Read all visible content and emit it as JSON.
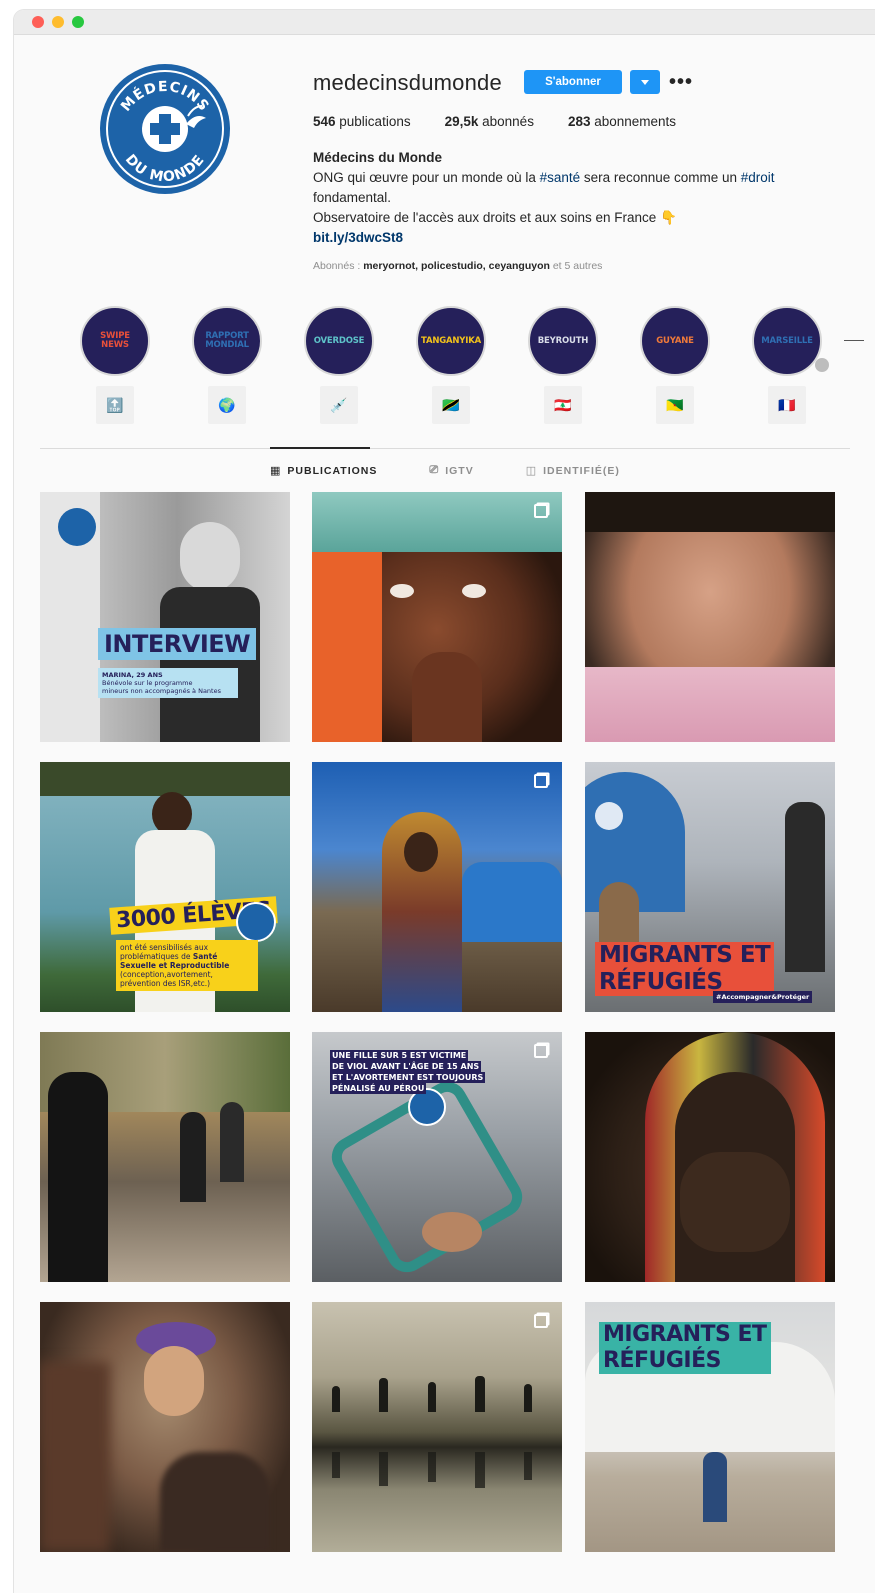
{
  "profile": {
    "username": "medecinsdumonde",
    "follow_label": "S'abonner",
    "more_label": "•••",
    "stats": {
      "posts_count": "546",
      "posts_label": " publications",
      "followers_count": "29,5k",
      "followers_label": " abonnés",
      "following_count": "283",
      "following_label": " abonnements"
    },
    "bio": {
      "name": "Médecins du Monde",
      "line1_a": "ONG qui œuvre pour un monde où la ",
      "line1_tag1": "#santé",
      "line1_b": " sera reconnue comme un ",
      "line1_tag2": "#droit",
      "line2": "fondamental.",
      "line3": "Observatoire de l'accès aux droits et aux soins en France 👇",
      "link": "bit.ly/3dwcSt8"
    },
    "followed_by_prefix": "Abonnés : ",
    "followed_by_names": "meryornot, policestudio, ceyanguyon",
    "followed_by_suffix": " et 5 autres"
  },
  "logo": {
    "top_text": "MÉDECINS",
    "bottom_text": "DU MONDE",
    "color": "#1d63a8"
  },
  "highlights": [
    {
      "label": "SWIPE\nNEWS",
      "color": "#e8503a",
      "emoji": "🔝"
    },
    {
      "label": "RAPPORT\nMONDIAL",
      "color": "#2f6fb3",
      "emoji": "🌍"
    },
    {
      "label": "OVERDOSE",
      "color": "#5ec3c9",
      "emoji": "💉"
    },
    {
      "label": "TANGANYIKA",
      "color": "#f2c21b",
      "emoji": "🇹🇿"
    },
    {
      "label": "BEYROUTH",
      "color": "#d9dde8",
      "emoji": "🇱🇧"
    },
    {
      "label": "GUYANE",
      "color": "#f07a3a",
      "emoji": "🇬🇫"
    },
    {
      "label": "MARSEILLE",
      "color": "#2f6fb3",
      "emoji": "🇫🇷"
    }
  ],
  "tabs": [
    {
      "label": "PUBLICATIONS",
      "icon": "grid-icon",
      "glyph": "▦"
    },
    {
      "label": "IGTV",
      "icon": "igtv-icon",
      "glyph": "⎚"
    },
    {
      "label": "IDENTIFIÉ(E)",
      "icon": "tagged-icon",
      "glyph": "◫"
    }
  ],
  "posts": {
    "p1": {
      "title": "INTERVIEW",
      "subtitle_bold": "MARINA, 29 ANS",
      "subtitle_1": "Bénévole sur le programme",
      "subtitle_2": "mineurs non accompagnés à Nantes"
    },
    "p4": {
      "title": "3000 ÉLÈVES",
      "line1": "ont été sensibilisés aux",
      "line2a": "problématiques de ",
      "line2b": "Santé",
      "line3": "Sexuelle et Reproductible",
      "line4": "(conception,avortement,",
      "line5": "prévention des ISR,etc.)"
    },
    "p6": {
      "title_1": "MIGRANTS ET",
      "title_2": "RÉFUGIÉS",
      "hashtag": "#Accompagner&Protéger"
    },
    "p8": {
      "line1": "UNE FILLE SUR 5 EST VICTIME",
      "line2": "DE VIOL AVANT L'ÂGE DE 15 ANS",
      "line3": "ET L'AVORTEMENT EST TOUJOURS",
      "line4": "PÉNALISÉ AU PÉROU"
    },
    "p12": {
      "title_1": "MIGRANTS ET",
      "title_2": "RÉFUGIÉS"
    }
  },
  "colors": {
    "follow_blue": "#1e95f6",
    "highlight_navy": "#25205a",
    "hashtag_blue": "#00376b"
  }
}
